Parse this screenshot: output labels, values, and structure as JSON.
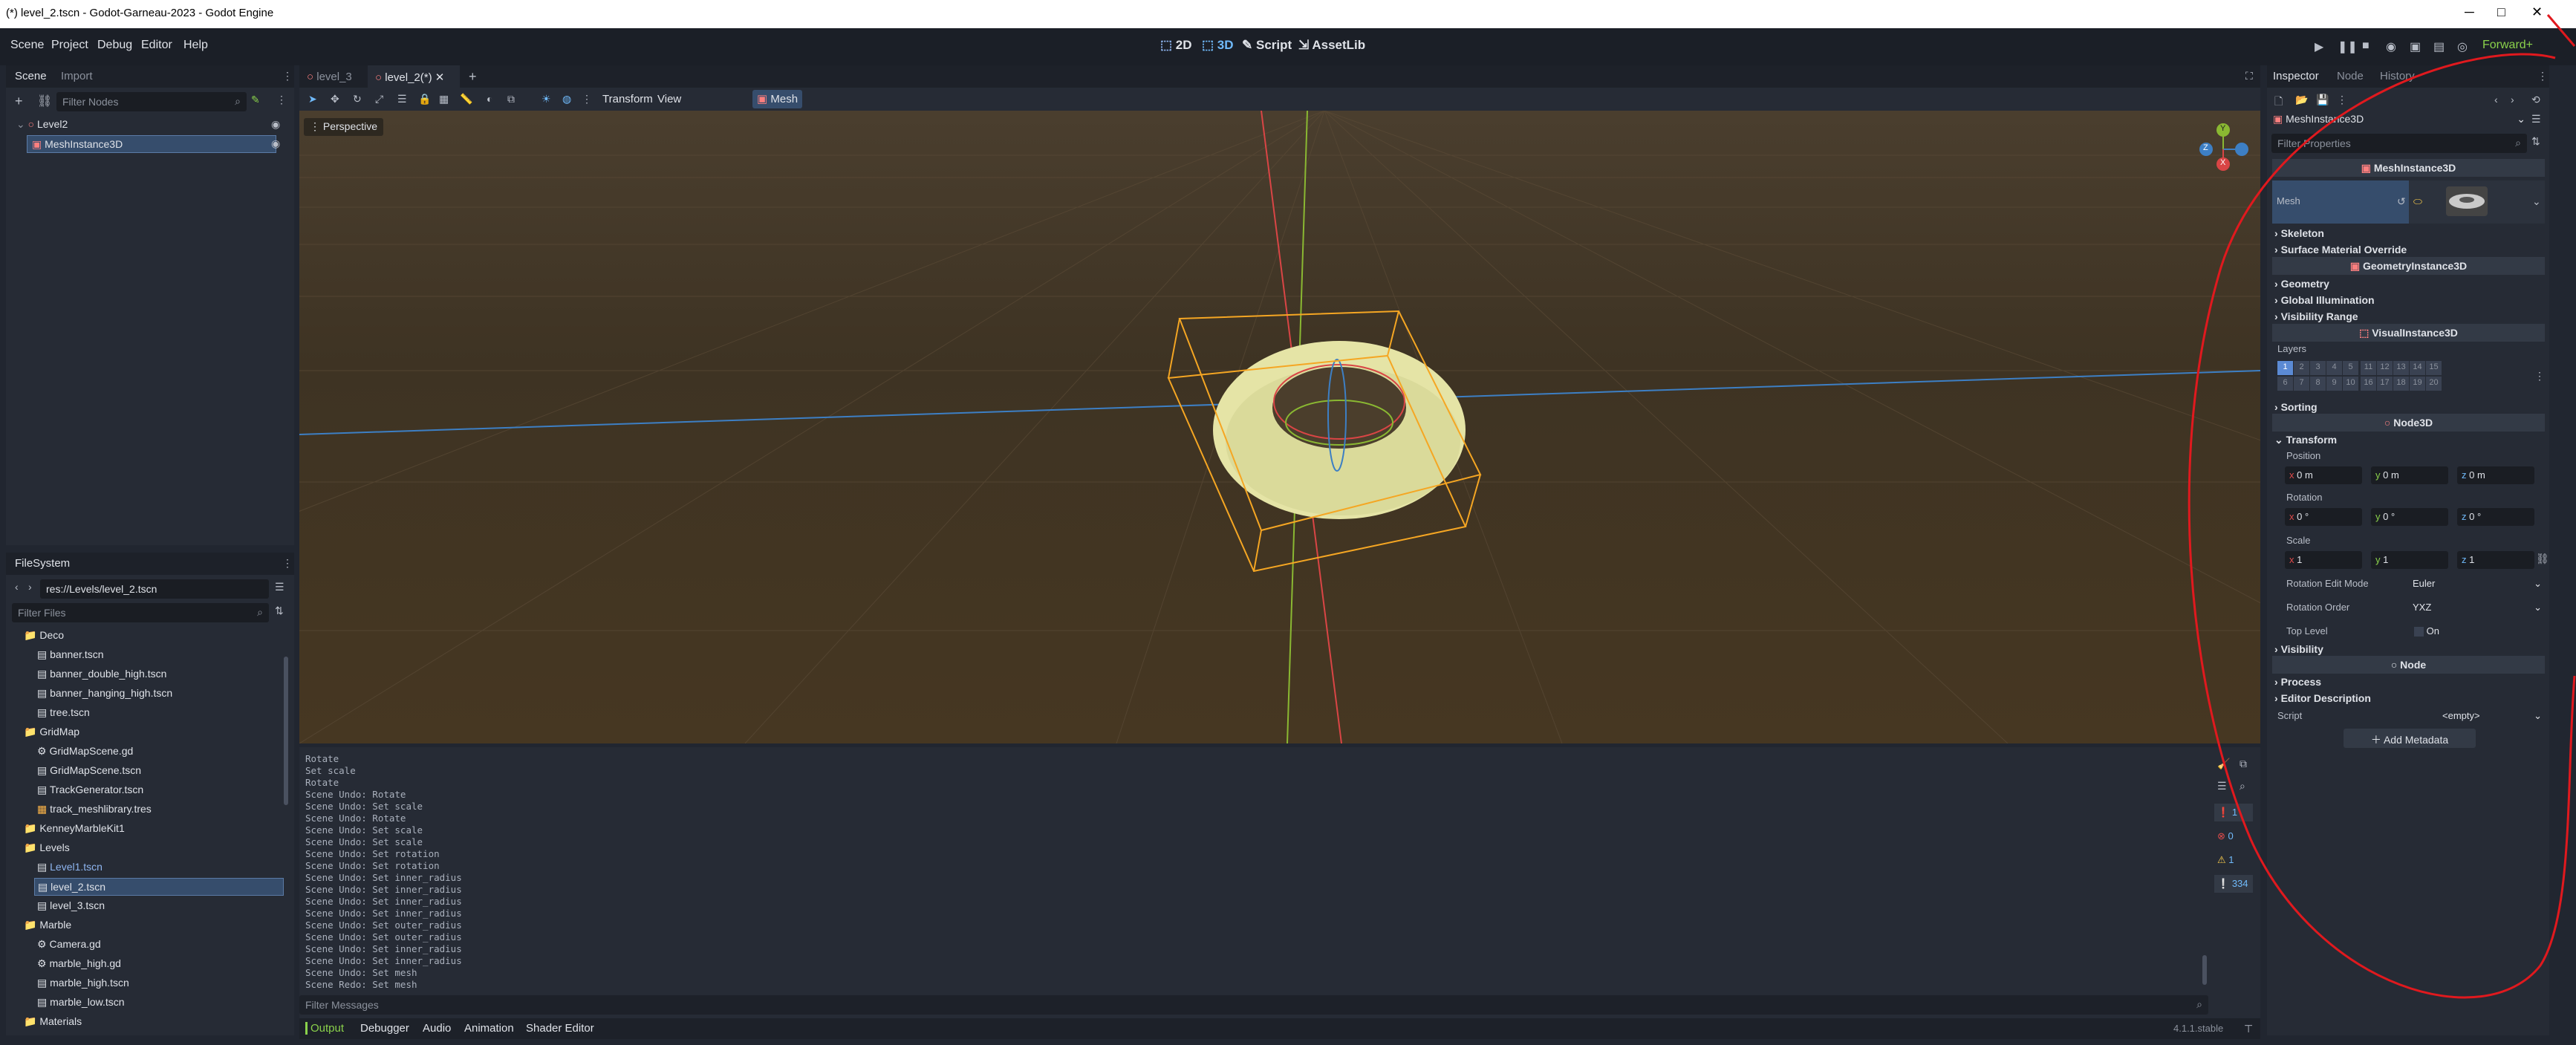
{
  "window": {
    "title": "(*) level_2.tscn - Godot-Garneau-2023 - Godot Engine",
    "min": "─",
    "max": "□",
    "close": "✕"
  },
  "menu": [
    "Scene",
    "Project",
    "Debug",
    "Editor",
    "Help"
  ],
  "workspaces": [
    "2D",
    "3D",
    "Script",
    "AssetLib"
  ],
  "renderer": "Forward+",
  "scene_dock": {
    "tabs": [
      "Scene",
      "Import"
    ],
    "filter_placeholder": "Filter Nodes",
    "nodes": [
      "Level2",
      "MeshInstance3D"
    ]
  },
  "filesystem": {
    "title": "FileSystem",
    "path": "res://Levels/level_2.tscn",
    "filter_placeholder": "Filter Files",
    "items": [
      {
        "name": "Deco",
        "type": "folder",
        "indent": 1
      },
      {
        "name": "banner.tscn",
        "type": "scene",
        "indent": 2
      },
      {
        "name": "banner_double_high.tscn",
        "type": "scene",
        "indent": 2
      },
      {
        "name": "banner_hanging_high.tscn",
        "type": "scene",
        "indent": 2
      },
      {
        "name": "tree.tscn",
        "type": "scene",
        "indent": 2
      },
      {
        "name": "GridMap",
        "type": "folder",
        "indent": 1
      },
      {
        "name": "GridMapScene.gd",
        "type": "script",
        "indent": 2
      },
      {
        "name": "GridMapScene.tscn",
        "type": "scene",
        "indent": 2
      },
      {
        "name": "TrackGenerator.tscn",
        "type": "scene",
        "indent": 2
      },
      {
        "name": "track_meshlibrary.tres",
        "type": "res",
        "indent": 2
      },
      {
        "name": "KenneyMarbleKit1",
        "type": "folder",
        "indent": 1
      },
      {
        "name": "Levels",
        "type": "folder",
        "indent": 1
      },
      {
        "name": "Level1.tscn",
        "type": "scene",
        "indent": 2
      },
      {
        "name": "level_2.tscn",
        "type": "scene",
        "indent": 2
      },
      {
        "name": "level_3.tscn",
        "type": "scene",
        "indent": 2
      },
      {
        "name": "Marble",
        "type": "folder",
        "indent": 1
      },
      {
        "name": "Camera.gd",
        "type": "script",
        "indent": 2
      },
      {
        "name": "marble_high.gd",
        "type": "script",
        "indent": 2
      },
      {
        "name": "marble_high.tscn",
        "type": "scene",
        "indent": 2
      },
      {
        "name": "marble_low.tscn",
        "type": "scene",
        "indent": 2
      },
      {
        "name": "Materials",
        "type": "folder",
        "indent": 1
      }
    ]
  },
  "editor_tabs": [
    "level_3",
    "level_2(*)"
  ],
  "toolbar": {
    "transform": "Transform",
    "view": "View",
    "mesh": "Mesh"
  },
  "viewport": {
    "perspective": "Perspective",
    "gizmo": {
      "y": "Y",
      "z": "Z",
      "x": "X"
    }
  },
  "output": {
    "lines": [
      "Rotate",
      "Set scale",
      "Rotate",
      "Scene Undo: Rotate",
      "Scene Undo: Set scale",
      "Scene Undo: Rotate",
      "Scene Undo: Set scale",
      "Scene Undo: Set scale",
      "Scene Undo: Set rotation",
      "Scene Undo: Set rotation",
      "Scene Undo: Set inner_radius",
      "Scene Undo: Set inner_radius",
      "Scene Undo: Set inner_radius",
      "Scene Undo: Set inner_radius",
      "Scene Undo: Set outer_radius",
      "Scene Undo: Set outer_radius",
      "Scene Undo: Set inner_radius",
      "Scene Undo: Set inner_radius",
      "Scene Undo: Set mesh",
      "Scene Redo: Set mesh"
    ],
    "filter_placeholder": "Filter Messages",
    "counts": [
      "1",
      "0",
      "1",
      "334"
    ]
  },
  "bottom_tabs": [
    "Output",
    "Debugger",
    "Audio",
    "Animation",
    "Shader Editor"
  ],
  "version": "4.1.1.stable",
  "inspector": {
    "tabs": [
      "Inspector",
      "Node",
      "History"
    ],
    "object": "MeshInstance3D",
    "filter_placeholder": "Filter Properties",
    "class_mesh": "MeshInstance3D",
    "mesh_label": "Mesh",
    "sections1": [
      "Skeleton",
      "Surface Material Override"
    ],
    "class_geom": "GeometryInstance3D",
    "sections2": [
      "Geometry",
      "Global Illumination",
      "Visibility Range"
    ],
    "class_visual": "VisualInstance3D",
    "layers_label": "Layers",
    "layers_row1": [
      "1",
      "2",
      "3",
      "4",
      "5",
      "11",
      "12",
      "13",
      "14",
      "15"
    ],
    "layers_row2": [
      "6",
      "7",
      "8",
      "9",
      "10",
      "16",
      "17",
      "18",
      "19",
      "20"
    ],
    "sorting": "Sorting",
    "class_node3d": "Node3D",
    "transform": "Transform",
    "position_label": "Position",
    "position": {
      "x": "0 m",
      "y": "0 m",
      "z": "0 m"
    },
    "rotation_label": "Rotation",
    "rotation": {
      "x": "0 °",
      "y": "0 °",
      "z": "0 °"
    },
    "scale_label": "Scale",
    "scale": {
      "x": "1",
      "y": "1",
      "z": "1"
    },
    "rot_edit_mode_label": "Rotation Edit Mode",
    "rot_edit_mode": "Euler",
    "rot_order_label": "Rotation Order",
    "rot_order": "YXZ",
    "top_level_label": "Top Level",
    "top_level": "On",
    "visibility": "Visibility",
    "class_node": "Node",
    "sections3": [
      "Process",
      "Editor Description"
    ],
    "script_label": "Script",
    "script_value": "<empty>",
    "add_metadata": "Add Metadata"
  },
  "colors": {
    "accent": "#70bafa",
    "annotation": "#e0191e",
    "selection": "#364d6c"
  }
}
